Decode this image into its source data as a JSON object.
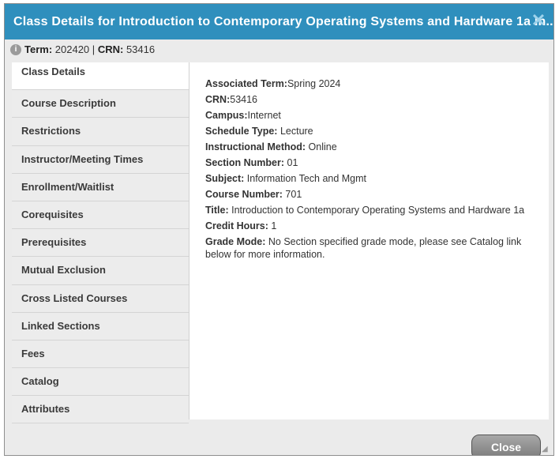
{
  "dialog": {
    "title": "Class Details for Introduction to Contemporary Operating Systems and Hardware 1a In...",
    "close_icon": "close-icon"
  },
  "term_bar": {
    "term_label": "Term:",
    "term_value": "202420",
    "separator": "|",
    "crn_label": "CRN:",
    "crn_value": "53416"
  },
  "tabs": [
    {
      "label": "Class Details",
      "active": true
    },
    {
      "label": "Course Description"
    },
    {
      "label": "Restrictions"
    },
    {
      "label": "Instructor/Meeting Times"
    },
    {
      "label": "Enrollment/Waitlist"
    },
    {
      "label": "Corequisites"
    },
    {
      "label": "Prerequisites"
    },
    {
      "label": "Mutual Exclusion"
    },
    {
      "label": "Cross Listed Courses"
    },
    {
      "label": "Linked Sections"
    },
    {
      "label": "Fees"
    },
    {
      "label": "Catalog"
    },
    {
      "label": "Attributes"
    }
  ],
  "details": [
    {
      "label": "Associated Term:",
      "value": "Spring 2024"
    },
    {
      "label": "CRN:",
      "value": "53416"
    },
    {
      "label": "Campus:",
      "value": "Internet"
    },
    {
      "label": "Schedule Type:",
      "value": " Lecture"
    },
    {
      "label": "Instructional Method:",
      "value": " Online"
    },
    {
      "label": "Section Number:",
      "value": " 01"
    },
    {
      "label": "Subject:",
      "value": " Information Tech and Mgmt"
    },
    {
      "label": "Course Number:",
      "value": " 701"
    },
    {
      "label": "Title:",
      "value": " Introduction to Contemporary Operating Systems and Hardware 1a"
    },
    {
      "label": "Credit Hours:",
      "value": " 1"
    },
    {
      "label": "Grade Mode:",
      "value": " No Section specified grade mode, please see Catalog link below for more information."
    }
  ],
  "footer": {
    "close_label": "Close"
  }
}
